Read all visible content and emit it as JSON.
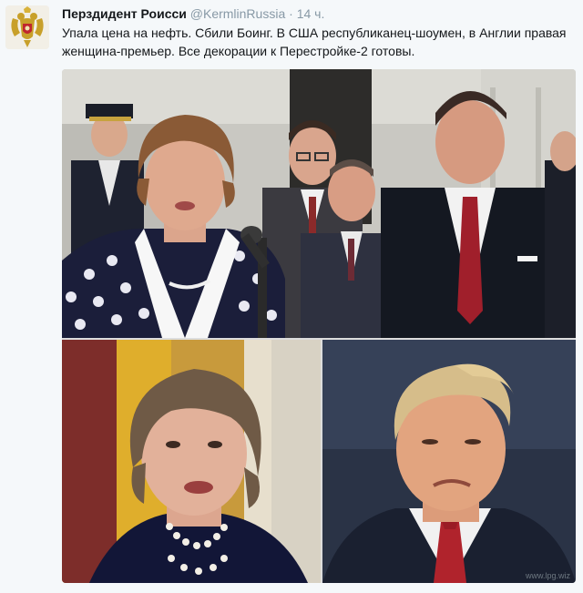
{
  "tweet": {
    "author_name": "Перздидент Роисси",
    "author_handle": "@KermlinRussia",
    "separator": "·",
    "time": "14 ч.",
    "text": "Упала цена на нефть. Сбили Боинг. В США республиканец-шоумен, в Англии правая женщина-премьер. Все декорации к Перестройке-2 готовы.",
    "avatar_icon": "double-headed-eagle-emblem-icon"
  },
  "media": {
    "photos": [
      {
        "name": "photo-thatcher-reagan"
      },
      {
        "name": "photo-theresa-may"
      },
      {
        "name": "photo-donald-trump"
      }
    ],
    "watermark": "www.lpg.wiz"
  }
}
